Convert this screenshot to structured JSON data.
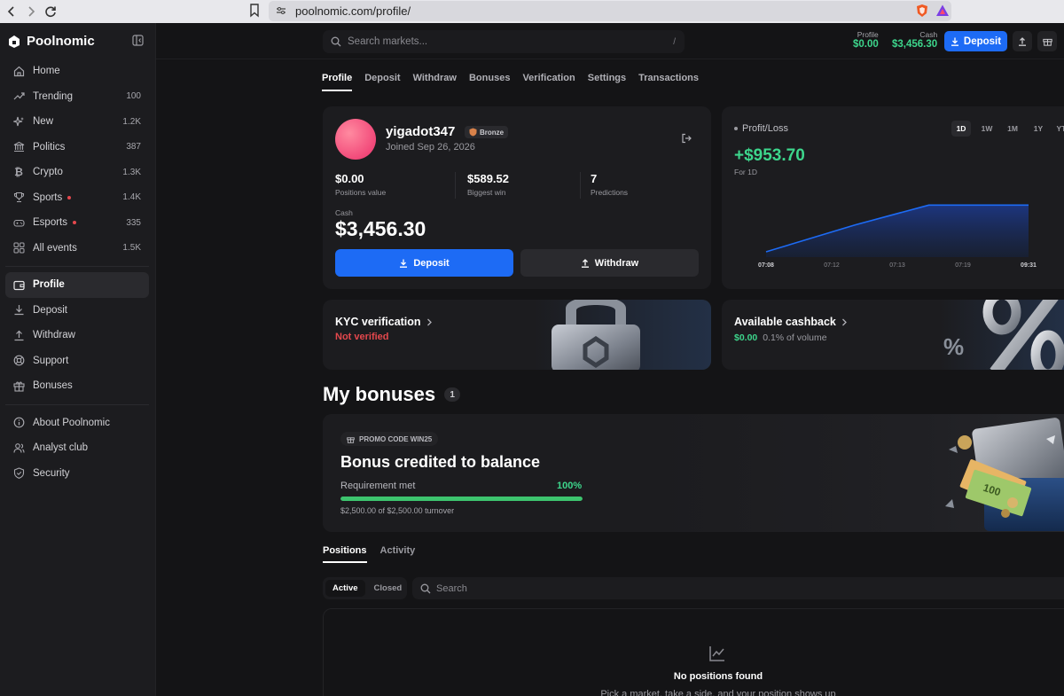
{
  "browser": {
    "url": "poolnomic.com/profile/"
  },
  "brand": {
    "name": "Poolnomic"
  },
  "sidebar": {
    "items": [
      {
        "label": "Home",
        "icon": "home-icon",
        "count": ""
      },
      {
        "label": "Trending",
        "icon": "trending-icon",
        "count": "100"
      },
      {
        "label": "New",
        "icon": "sparkle-icon",
        "count": "1.2K"
      },
      {
        "label": "Politics",
        "icon": "building-icon",
        "count": "387"
      },
      {
        "label": "Crypto",
        "icon": "bitcoin-icon",
        "count": "1.3K"
      },
      {
        "label": "Sports",
        "icon": "trophy-icon",
        "count": "1.4K",
        "live": true
      },
      {
        "label": "Esports",
        "icon": "gamepad-icon",
        "count": "335",
        "live": true
      },
      {
        "label": "All events",
        "icon": "grid-icon",
        "count": "1.5K"
      }
    ],
    "account": [
      {
        "label": "Profile",
        "icon": "wallet-icon",
        "active": true
      },
      {
        "label": "Deposit",
        "icon": "download-icon"
      },
      {
        "label": "Withdraw",
        "icon": "upload-icon"
      },
      {
        "label": "Support",
        "icon": "lifebuoy-icon"
      },
      {
        "label": "Bonuses",
        "icon": "gift-icon"
      }
    ],
    "info": [
      {
        "label": "About Poolnomic",
        "icon": "info-icon"
      },
      {
        "label": "Analyst club",
        "icon": "users-icon"
      },
      {
        "label": "Security",
        "icon": "shield-icon"
      }
    ]
  },
  "header": {
    "search_placeholder": "Search markets...",
    "search_shortcut": "/",
    "profile_label": "Profile",
    "profile_value": "$0.00",
    "cash_label": "Cash",
    "cash_value": "$3,456.30",
    "deposit_label": "Deposit"
  },
  "tabs": [
    "Profile",
    "Deposit",
    "Withdraw",
    "Bonuses",
    "Verification",
    "Settings",
    "Transactions"
  ],
  "profile": {
    "username": "yigadot347",
    "rank": "Bronze",
    "joined": "Joined Sep 26, 2026",
    "stats": [
      {
        "value": "$0.00",
        "label": "Positions value"
      },
      {
        "value": "$589.52",
        "label": "Biggest win"
      },
      {
        "value": "7",
        "label": "Predictions"
      }
    ],
    "cash_label": "Cash",
    "cash_value": "$3,456.30",
    "deposit_label": "Deposit",
    "withdraw_label": "Withdraw"
  },
  "profit_loss": {
    "title": "Profit/Loss",
    "ranges": [
      "1D",
      "1W",
      "1M",
      "1Y",
      "YTD"
    ],
    "active_range": "1D",
    "value": "+$953.70",
    "period": "For 1D",
    "accent": "#3dd68c"
  },
  "chart_data": {
    "type": "area",
    "x": [
      "07:08",
      "07:12",
      "07:13",
      "07:19",
      "09:31"
    ],
    "values": [
      0,
      550,
      953.7,
      953.7,
      953.7
    ],
    "title": "",
    "xlabel": "",
    "ylabel": "",
    "grid": false,
    "color": "#1d6bf5"
  },
  "kyc": {
    "title": "KYC verification",
    "status": "Not verified"
  },
  "cashback": {
    "title": "Available cashback",
    "value": "$0.00",
    "rate": "0.1% of volume"
  },
  "bonuses": {
    "title": "My bonuses",
    "count": "1",
    "promo": "PROMO CODE WIN25",
    "headline": "Bonus credited to balance",
    "requirement_label": "Requirement met",
    "requirement_pct": "100%",
    "progress": 1.0,
    "turnover": "$2,500.00 of $2,500.00 turnover"
  },
  "positions": {
    "tabs": [
      "Positions",
      "Activity"
    ],
    "filters": [
      "Active",
      "Closed"
    ],
    "search_placeholder": "Search",
    "empty_title": "No positions found",
    "empty_sub": "Pick a market, take a side, and your position shows up"
  }
}
